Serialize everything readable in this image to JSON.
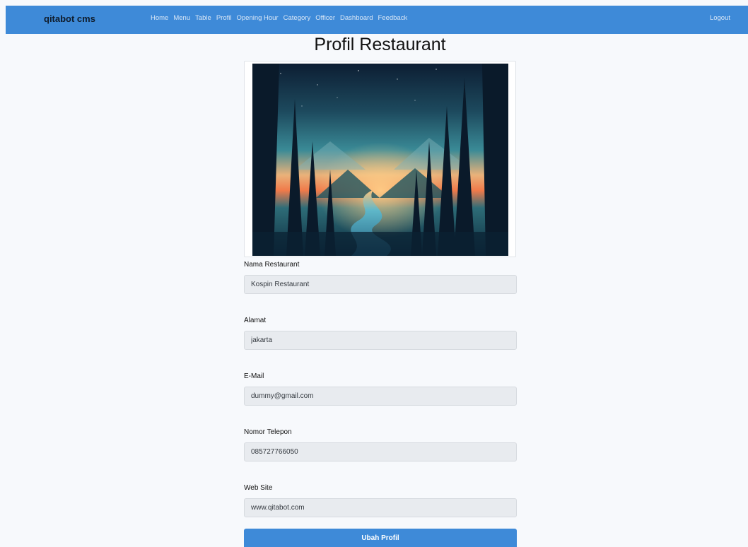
{
  "navbar": {
    "brand": "qitabot cms",
    "links": [
      "Home",
      "Menu",
      "Table",
      "Profil",
      "Opening Hour",
      "Category",
      "Officer",
      "Dashboard",
      "Feedback"
    ],
    "logout": "Logout",
    "color": "#3e8ad8"
  },
  "page": {
    "title": "Profil Restaurant"
  },
  "form": {
    "fields": [
      {
        "label": "Nama Restaurant",
        "value": "Kospin Restaurant"
      },
      {
        "label": "Alamat",
        "value": "jakarta"
      },
      {
        "label": "E-Mail",
        "value": "dummy@gmail.com"
      },
      {
        "label": "Nomor Telepon",
        "value": "085727766050"
      },
      {
        "label": "Web Site",
        "value": "www.qitabot.com"
      }
    ],
    "submit_label": "Ubah Profil"
  },
  "image": {
    "subject": "forest-river-landscape-illustration"
  }
}
